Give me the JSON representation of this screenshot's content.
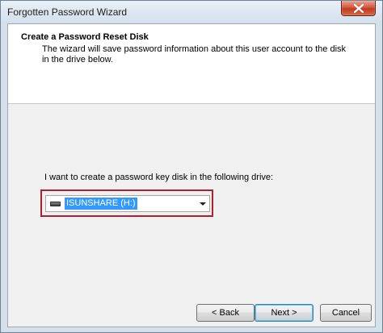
{
  "window": {
    "title": "Forgotten Password Wizard"
  },
  "header": {
    "title": "Create a Password Reset Disk",
    "description": "The wizard will save password information about this user account to the disk in the drive below."
  },
  "main": {
    "prompt": "I want to create a password key disk in the following drive:",
    "drive_select": {
      "selected": "ISUNSHARE (H:)",
      "icon": "usb-drive-icon"
    }
  },
  "buttons": {
    "back": "< Back",
    "next": "Next >",
    "cancel": "Cancel"
  },
  "colors": {
    "selection": "#3399ff",
    "highlight_border": "#b0202c",
    "close_button": "#c13a1c"
  }
}
